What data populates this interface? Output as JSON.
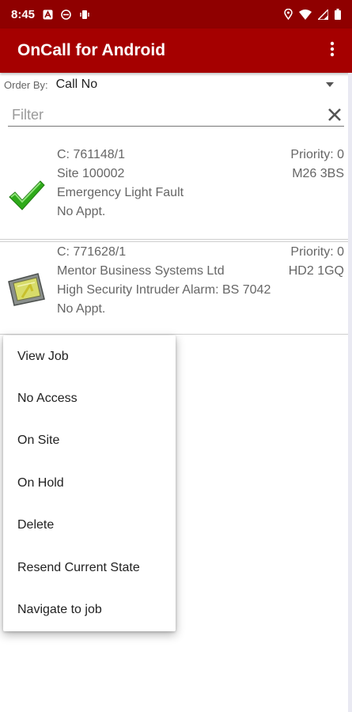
{
  "status_bar": {
    "time": "8:45",
    "left_icons": [
      "a-icon",
      "s-icon",
      "vibrate-icon"
    ],
    "right_icons": [
      "location-icon",
      "wifi-icon",
      "signal-icon",
      "battery-icon"
    ]
  },
  "app_bar": {
    "title": "OnCall for Android",
    "overflow_icon": "more-vert-icon"
  },
  "order_by": {
    "label": "Order By:",
    "value": "Call No"
  },
  "filter": {
    "placeholder": "Filter",
    "value": "",
    "clear_icon": "close-icon"
  },
  "jobs": [
    {
      "call": "C: 761148/1",
      "site": "Site 100002",
      "description": "Emergency Light Fault",
      "appointment": "No Appt.",
      "priority": "Priority: 0",
      "postcode": "M26 3BS",
      "status_icon": "checkmark-icon"
    },
    {
      "call": "C: 771628/1",
      "site": "Mentor Business Systems Ltd",
      "description": "High Security Intruder Alarm: BS 7042",
      "appointment": "No Appt.",
      "priority": "Priority: 0",
      "postcode": "HD2 1GQ",
      "status_icon": "gps-device-icon"
    }
  ],
  "context_menu": {
    "items": [
      {
        "label": "View Job"
      },
      {
        "label": "No Access"
      },
      {
        "label": "On Site"
      },
      {
        "label": "On Hold"
      },
      {
        "label": "Delete"
      },
      {
        "label": "Resend Current State"
      },
      {
        "label": "Navigate to job"
      }
    ]
  },
  "colors": {
    "status_bar": "#8f0000",
    "app_bar": "#a50000",
    "check_green": "#2faa1a"
  }
}
